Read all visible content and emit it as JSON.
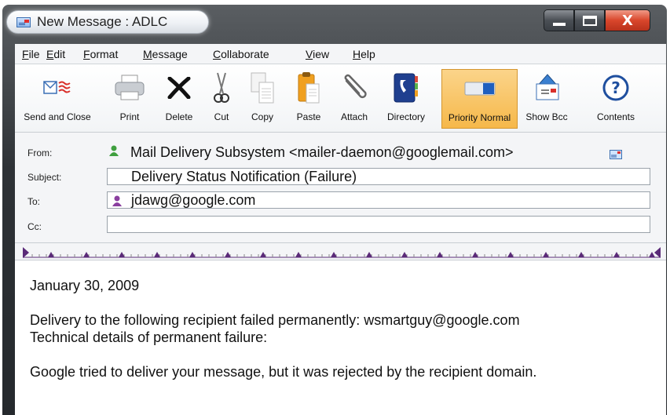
{
  "window": {
    "title": "New Message : ADLC"
  },
  "menu": {
    "file": "File",
    "edit": "Edit",
    "format": "Format",
    "message": "Message",
    "collaborate": "Collaborate",
    "view": "View",
    "help": "Help"
  },
  "toolbar": {
    "send_close": "Send and Close",
    "print": "Print",
    "delete": "Delete",
    "cut": "Cut",
    "copy": "Copy",
    "paste": "Paste",
    "attach": "Attach",
    "directory": "Directory",
    "priority": "Priority Normal",
    "show_bcc": "Show Bcc",
    "contents": "Contents"
  },
  "headers": {
    "from_label": "From:",
    "from_value": "Mail Delivery Subsystem <mailer-daemon@googlemail.com>",
    "subject_label": "Subject:",
    "subject_value": "Delivery Status Notification (Failure)",
    "to_label": "To:",
    "to_value": "jdawg@google.com",
    "cc_label": "Cc:",
    "cc_value": ""
  },
  "body": {
    "date": "January 30, 2009",
    "line1": "Delivery to the following recipient failed permanently: wsmartguy@google.com",
    "line2": "Technical details of permanent failure:",
    "line3": "Google tried to deliver your message, but it was rejected by the recipient domain."
  },
  "colors": {
    "titlebar": "#2e3236",
    "close_button": "#d9462b",
    "priority_highlight": "#f6b84a",
    "ruler_marker": "#5a2a78"
  }
}
